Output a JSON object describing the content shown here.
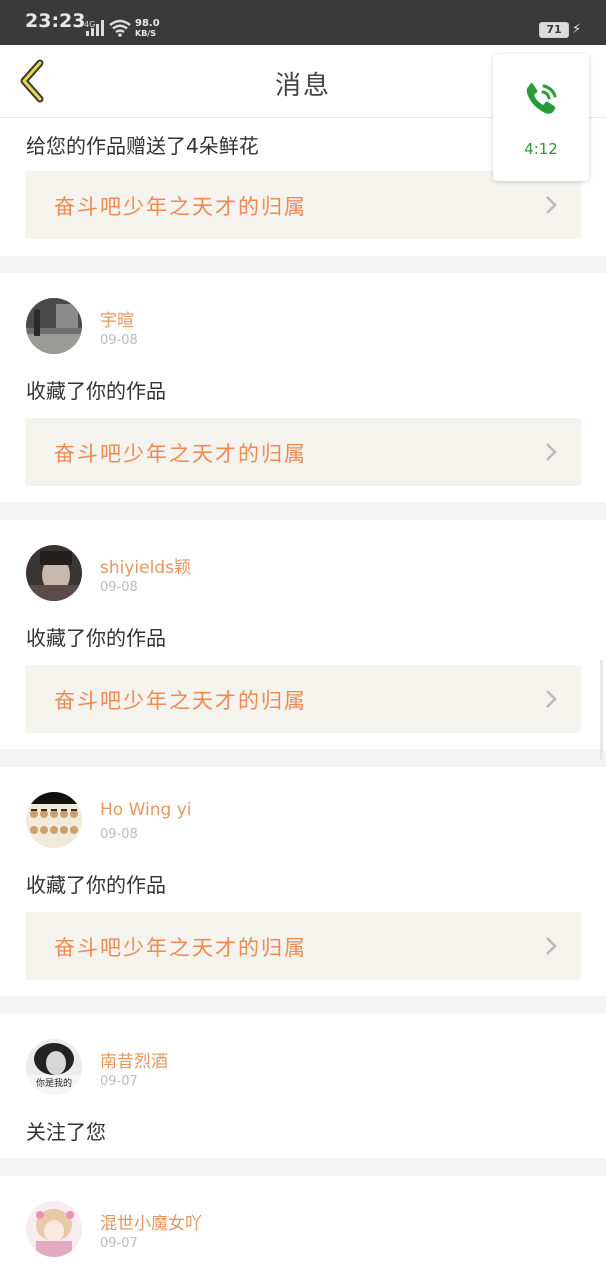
{
  "status_bar": {
    "time": "23:23",
    "network": "4G",
    "speed_value": "98.0",
    "speed_unit": "KB/S",
    "battery": "71"
  },
  "header": {
    "title": "消息",
    "back_icon": "chevron-left-icon"
  },
  "call_widget": {
    "icon": "phone-call-icon",
    "duration": "4:12",
    "color": "#2a9a3a"
  },
  "colors": {
    "accent": "#e8965f",
    "work_bg": "#f4f3ed",
    "work_text": "#ec8a52"
  },
  "messages": [
    {
      "action": "给您的作品赠送了4朵鲜花",
      "work_title": "奋斗吧少年之天才的归属"
    },
    {
      "user": "宇暄",
      "date": "09-08",
      "action": "收藏了你的作品",
      "work_title": "奋斗吧少年之天才的归属"
    },
    {
      "user": "shiyields颖",
      "date": "09-08",
      "action": "收藏了你的作品",
      "work_title": "奋斗吧少年之天才的归属"
    },
    {
      "user": "Ho Wing yi",
      "date": "09-08",
      "action": "收藏了你的作品",
      "work_title": "奋斗吧少年之天才的归属"
    },
    {
      "user": "南昔烈酒",
      "date": "09-07",
      "action": "关注了您",
      "avatar_text": "你是我的"
    },
    {
      "user": "混世小魔女吖",
      "date": "09-07"
    }
  ]
}
